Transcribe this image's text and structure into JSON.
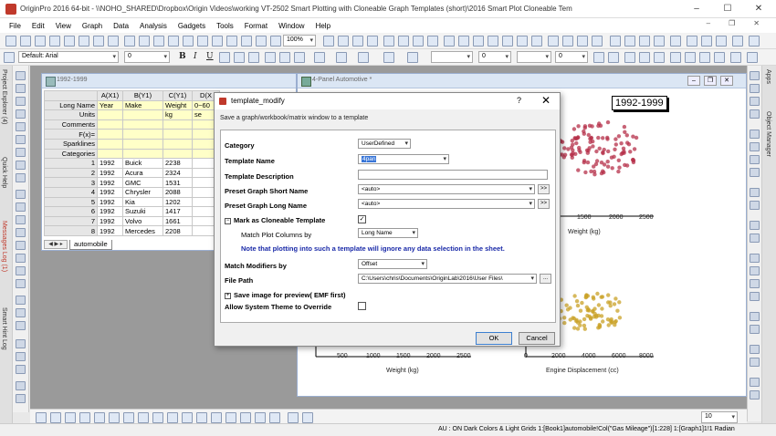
{
  "window": {
    "title": "OriginPro 2016 64-bit - \\\\NOHO_SHARED\\Dropbox\\Origin Videos\\working VT-2502 Smart Plotting with Cloneable Graph Templates (short)\\2016 Smart Plot Cloneable Tem",
    "minimize": "–",
    "maximize": "☐",
    "close": "✕"
  },
  "menu": [
    "File",
    "Edit",
    "View",
    "Graph",
    "Data",
    "Analysis",
    "Gadgets",
    "Tools",
    "Format",
    "Window",
    "Help"
  ],
  "toolbar": {
    "zoom": "100%",
    "font": "Default: Arial",
    "font_size": "0",
    "bold": "B",
    "italic": "I",
    "underline": "U",
    "size_field": "0",
    "size_field2": "0",
    "size_field3": "10"
  },
  "left_panels": [
    "Project Explorer (4)",
    "Quick Help",
    "Messages Log (1)",
    "Smart Hint Log"
  ],
  "right_panels": [
    "Apps",
    "Object Manager"
  ],
  "workbook": {
    "title": "1992-1999",
    "columns": [
      "A(X1)",
      "B(Y1)",
      "C(Y1)",
      "D(X"
    ],
    "row_headers": [
      "Long Name",
      "Units",
      "Comments",
      "F(x)=",
      "Sparklines",
      "Categories"
    ],
    "long_names": [
      "Year",
      "Make",
      "Weight",
      "0~60"
    ],
    "units": [
      "",
      "",
      "kg",
      "se"
    ],
    "rows": [
      {
        "n": "1",
        "year": "1992",
        "make": "Buick",
        "weight": "2238"
      },
      {
        "n": "2",
        "year": "1992",
        "make": "Acura",
        "weight": "2324"
      },
      {
        "n": "3",
        "year": "1992",
        "make": "GMC",
        "weight": "1531"
      },
      {
        "n": "4",
        "year": "1992",
        "make": "Chrysler",
        "weight": "2088"
      },
      {
        "n": "5",
        "year": "1992",
        "make": "Kia",
        "weight": "1202"
      },
      {
        "n": "6",
        "year": "1992",
        "make": "Suzuki",
        "weight": "1417"
      },
      {
        "n": "7",
        "year": "1992",
        "make": "Volvo",
        "weight": "1661"
      },
      {
        "n": "8",
        "year": "1992",
        "make": "Mercedes",
        "weight": "2208"
      }
    ],
    "sheet_tab": "automobile"
  },
  "graph": {
    "title": "4-Panel Automotive *",
    "year_label": "1992-1999",
    "top_x_ticks": [
      "1500",
      "2000",
      "2500"
    ],
    "top_x_label": "Weight (kg)",
    "bottom_left_ticks": [
      "500",
      "1000",
      "1500",
      "2000",
      "2500"
    ],
    "bottom_left_label": "Weight (kg)",
    "bottom_right_ticks": [
      "0",
      "2000",
      "4000",
      "6000",
      "8000"
    ],
    "bottom_right_label": "Engine Displacement (cc)"
  },
  "dialog": {
    "title": "template_modify",
    "help": "?",
    "close": "✕",
    "description": "Save a graph/workbook/matrix window to a template",
    "category_label": "Category",
    "category_value": "UserDefined",
    "template_name_label": "Template Name",
    "template_name_value": "4pan",
    "template_desc_label": "Template Description",
    "template_desc_value": "",
    "short_name_label": "Preset Graph Short Name",
    "short_name_value": "<auto>",
    "long_name_label": "Preset Graph Long Name",
    "long_name_value": "<auto>",
    "expand_btn": ">>",
    "cloneable_label": "Mark as Cloneable Template",
    "cloneable_checked": "✓",
    "collapse_minus": "−",
    "collapse_plus": "+",
    "match_plot_label": "Match Plot Columns by",
    "match_plot_value": "Long Name",
    "note": "Note that plotting into such a template will ignore any data selection in the sheet.",
    "match_modifiers_label": "Match Modifiers by",
    "match_modifiers_value": "Offset",
    "file_path_label": "File Path",
    "file_path_value": "C:\\Users\\chris\\Documents\\OriginLab\\2016\\User Files\\",
    "browse_btn": "...",
    "save_preview_label": "Save image for preview( EMF first)",
    "allow_theme_label": "Allow System Theme to Override",
    "ok": "OK",
    "cancel": "Cancel"
  },
  "statusbar": "AU : ON  Dark Colors & Light Grids  1:[Book1]automobile!Col(\"Gas Mileage\")[1:228]  1:[Graph1]1!1  Radian",
  "chart_data": [
    {
      "type": "scatter",
      "title": "",
      "xlabel": "Weight (kg)",
      "x_ticks": [
        1500,
        2000,
        2500
      ],
      "color": "#b5304a"
    },
    {
      "type": "scatter",
      "title": "",
      "xlabel": "Weight (kg)",
      "x_ticks": [
        500,
        1000,
        1500,
        2000,
        2500
      ]
    },
    {
      "type": "scatter",
      "title": "",
      "xlabel": "Engine Displacement (cc)",
      "x_ticks": [
        0,
        2000,
        4000,
        6000,
        8000
      ],
      "color": "#c9a227"
    }
  ]
}
